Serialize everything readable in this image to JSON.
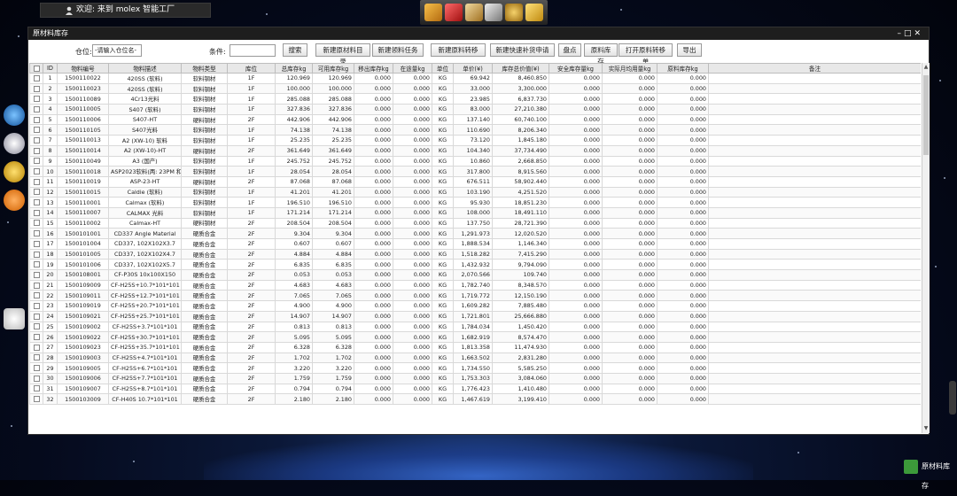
{
  "topbar": {
    "welcome": "欢迎: 来到 molex 智能工厂"
  },
  "window": {
    "title": "原材料库存",
    "controls": "–□✕"
  },
  "toolbar": {
    "location_label": "仓位:",
    "location_placeholder": "-请输入仓位名-",
    "condition_label": "条件:",
    "search_btn": "搜索",
    "btn_new_catalog": "新建原材料目录",
    "btn_new_task": "新建领料任务",
    "btn_new_transfer": "新建原料转移",
    "btn_quick_replenish": "新建快速补货申请",
    "btn_inventory": "盘点",
    "btn_stock": "原料库存",
    "btn_open_transfer": "打开原料转移单",
    "btn_export": "导出"
  },
  "table": {
    "headers": [
      "",
      "ID",
      "物料编号",
      "物料描述",
      "物料类型",
      "库位",
      "总库存kg",
      "可用库存kg",
      "移出库存kg",
      "在途量kg",
      "单位",
      "单价(¥)",
      "库存总价值(¥)",
      "安全库存量kg",
      "实际月均用量kg",
      "原料库存kg",
      "备注"
    ],
    "rows": [
      [
        "1",
        "1500110022",
        "420SS (软料)",
        "软料钢材",
        "1F",
        "120.969",
        "120.969",
        "0.000",
        "0.000",
        "KG",
        "69.942",
        "8,460.850",
        "0.000",
        "0.000",
        "0.000",
        ""
      ],
      [
        "2",
        "1500110023",
        "420SS (软料)",
        "软料钢材",
        "1F",
        "100.000",
        "100.000",
        "0.000",
        "0.000",
        "KG",
        "33.000",
        "3,300.000",
        "0.000",
        "0.000",
        "0.000",
        ""
      ],
      [
        "3",
        "1500110089",
        "4Cr13光料",
        "软料钢材",
        "1F",
        "285.088",
        "285.088",
        "0.000",
        "0.000",
        "KG",
        "23.985",
        "6,837.730",
        "0.000",
        "0.000",
        "0.000",
        ""
      ],
      [
        "4",
        "1500110005",
        "S407 (软料)",
        "软料钢材",
        "1F",
        "327.836",
        "327.836",
        "0.000",
        "0.000",
        "KG",
        "83.000",
        "27,210.380",
        "0.000",
        "0.000",
        "0.000",
        ""
      ],
      [
        "5",
        "1500110006",
        "S407-HT",
        "硬料钢材",
        "2F",
        "442.906",
        "442.906",
        "0.000",
        "0.000",
        "KG",
        "137.140",
        "60,740.100",
        "0.000",
        "0.000",
        "0.000",
        ""
      ],
      [
        "6",
        "1500110105",
        "S407光料",
        "软料钢材",
        "1F",
        "74.138",
        "74.138",
        "0.000",
        "0.000",
        "KG",
        "110.690",
        "8,206.340",
        "0.000",
        "0.000",
        "0.000",
        ""
      ],
      [
        "7",
        "1500110013",
        "A2 (XW-10) 软料",
        "软料钢材",
        "1F",
        "25.235",
        "25.235",
        "0.000",
        "0.000",
        "KG",
        "73.120",
        "1,845.180",
        "0.000",
        "0.000",
        "0.000",
        ""
      ],
      [
        "8",
        "1500110014",
        "A2 (XW-10)-HT",
        "硬料钢材",
        "2F",
        "361.649",
        "361.649",
        "0.000",
        "0.000",
        "KG",
        "104.340",
        "37,734.490",
        "0.000",
        "0.000",
        "0.000",
        ""
      ],
      [
        "9",
        "1500110049",
        "A3 (国产)",
        "软料钢材",
        "1F",
        "245.752",
        "245.752",
        "0.000",
        "0.000",
        "KG",
        "10.860",
        "2,668.850",
        "0.000",
        "0.000",
        "0.000",
        ""
      ],
      [
        "10",
        "1500110018",
        "ASP2023软料(两: 23PM 和ASSAB PM23)",
        "软料钢材",
        "1F",
        "28.054",
        "28.054",
        "0.000",
        "0.000",
        "KG",
        "317.800",
        "8,915.560",
        "0.000",
        "0.000",
        "0.000",
        ""
      ],
      [
        "11",
        "1500110019",
        "ASP-23-HT",
        "硬料钢材",
        "2F",
        "87.068",
        "87.068",
        "0.000",
        "0.000",
        "KG",
        "676.511",
        "58,902.440",
        "0.000",
        "0.000",
        "0.000",
        ""
      ],
      [
        "12",
        "1500110015",
        "Caldie (软料)",
        "软料钢材",
        "1F",
        "41.201",
        "41.201",
        "0.000",
        "0.000",
        "KG",
        "103.190",
        "4,251.520",
        "0.000",
        "0.000",
        "0.000",
        ""
      ],
      [
        "13",
        "1500110001",
        "Calmax (软料)",
        "软料钢材",
        "1F",
        "196.510",
        "196.510",
        "0.000",
        "0.000",
        "KG",
        "95.930",
        "18,851.230",
        "0.000",
        "0.000",
        "0.000",
        ""
      ],
      [
        "14",
        "1500110007",
        "CALMAX 光料",
        "软料钢材",
        "1F",
        "171.214",
        "171.214",
        "0.000",
        "0.000",
        "KG",
        "108.000",
        "18,491.110",
        "0.000",
        "0.000",
        "0.000",
        ""
      ],
      [
        "15",
        "1500110002",
        "Calmax-HT",
        "硬料钢材",
        "2F",
        "208.504",
        "208.504",
        "0.000",
        "0.000",
        "KG",
        "137.750",
        "28,721.390",
        "0.000",
        "0.000",
        "0.000",
        ""
      ],
      [
        "16",
        "1500101001",
        "CD337 Angle Material",
        "硬质合金",
        "2F",
        "9.304",
        "9.304",
        "0.000",
        "0.000",
        "KG",
        "1,291.973",
        "12,020.520",
        "0.000",
        "0.000",
        "0.000",
        ""
      ],
      [
        "17",
        "1500101004",
        "CD337, 102X102X3.7",
        "硬质合金",
        "2F",
        "0.607",
        "0.607",
        "0.000",
        "0.000",
        "KG",
        "1,888.534",
        "1,146.340",
        "0.000",
        "0.000",
        "0.000",
        ""
      ],
      [
        "18",
        "1500101005",
        "CD337, 102X102X4.7",
        "硬质合金",
        "2F",
        "4.884",
        "4.884",
        "0.000",
        "0.000",
        "KG",
        "1,518.282",
        "7,415.290",
        "0.000",
        "0.000",
        "0.000",
        ""
      ],
      [
        "19",
        "1500101006",
        "CD337, 102X102X5.7",
        "硬质合金",
        "2F",
        "6.835",
        "6.835",
        "0.000",
        "0.000",
        "KG",
        "1,432.932",
        "9,794.090",
        "0.000",
        "0.000",
        "0.000",
        ""
      ],
      [
        "20",
        "1500108001",
        "CF-P30S 10x100X150",
        "硬质合金",
        "2F",
        "0.053",
        "0.053",
        "0.000",
        "0.000",
        "KG",
        "2,070.566",
        "109.740",
        "0.000",
        "0.000",
        "0.000",
        ""
      ],
      [
        "21",
        "1500109009",
        "CF-H25S+10.7*101*101",
        "硬质合金",
        "2F",
        "4.683",
        "4.683",
        "0.000",
        "0.000",
        "KG",
        "1,782.740",
        "8,348.570",
        "0.000",
        "0.000",
        "0.000",
        ""
      ],
      [
        "22",
        "1500109011",
        "CF-H25S+12.7*101*101",
        "硬质合金",
        "2F",
        "7.065",
        "7.065",
        "0.000",
        "0.000",
        "KG",
        "1,719.772",
        "12,150.190",
        "0.000",
        "0.000",
        "0.000",
        ""
      ],
      [
        "23",
        "1500109019",
        "CF-H25S+20.7*101*101",
        "硬质合金",
        "2F",
        "4.900",
        "4.900",
        "0.000",
        "0.000",
        "KG",
        "1,609.282",
        "7,885.480",
        "0.000",
        "0.000",
        "0.000",
        ""
      ],
      [
        "24",
        "1500109021",
        "CF-H25S+25.7*101*101",
        "硬质合金",
        "2F",
        "14.907",
        "14.907",
        "0.000",
        "0.000",
        "KG",
        "1,721.801",
        "25,666.880",
        "0.000",
        "0.000",
        "0.000",
        ""
      ],
      [
        "25",
        "1500109002",
        "CF-H25S+3.7*101*101",
        "硬质合金",
        "2F",
        "0.813",
        "0.813",
        "0.000",
        "0.000",
        "KG",
        "1,784.034",
        "1,450.420",
        "0.000",
        "0.000",
        "0.000",
        ""
      ],
      [
        "26",
        "1500109022",
        "CF-H25S+30.7*101*101",
        "硬质合金",
        "2F",
        "5.095",
        "5.095",
        "0.000",
        "0.000",
        "KG",
        "1,682.919",
        "8,574.470",
        "0.000",
        "0.000",
        "0.000",
        ""
      ],
      [
        "27",
        "1500109023",
        "CF-H25S+35.7*101*101",
        "硬质合金",
        "2F",
        "6.328",
        "6.328",
        "0.000",
        "0.000",
        "KG",
        "1,813.358",
        "11,474.930",
        "0.000",
        "0.000",
        "0.000",
        ""
      ],
      [
        "28",
        "1500109003",
        "CF-H25S+4.7*101*101",
        "硬质合金",
        "2F",
        "1.702",
        "1.702",
        "0.000",
        "0.000",
        "KG",
        "1,663.502",
        "2,831.280",
        "0.000",
        "0.000",
        "0.000",
        ""
      ],
      [
        "29",
        "1500109005",
        "CF-H25S+6.7*101*101",
        "硬质合金",
        "2F",
        "3.220",
        "3.220",
        "0.000",
        "0.000",
        "KG",
        "1,734.550",
        "5,585.250",
        "0.000",
        "0.000",
        "0.000",
        ""
      ],
      [
        "30",
        "1500109006",
        "CF-H25S+7.7*101*101",
        "硬质合金",
        "2F",
        "1.759",
        "1.759",
        "0.000",
        "0.000",
        "KG",
        "1,753.303",
        "3,084.060",
        "0.000",
        "0.000",
        "0.000",
        ""
      ],
      [
        "31",
        "1500109007",
        "CF-H25S+8.7*101*101",
        "硬质合金",
        "2F",
        "0.794",
        "0.794",
        "0.000",
        "0.000",
        "KG",
        "1,776.423",
        "1,410.480",
        "0.000",
        "0.000",
        "0.000",
        ""
      ],
      [
        "32",
        "1500103009",
        "CF-H40S 10.7*101*101",
        "硬质合金",
        "2F",
        "2.180",
        "2.180",
        "0.000",
        "0.000",
        "KG",
        "1,467.619",
        "3,199.410",
        "0.000",
        "0.000",
        "0.000",
        ""
      ]
    ]
  },
  "bottom": {
    "label": "原材料库存"
  }
}
